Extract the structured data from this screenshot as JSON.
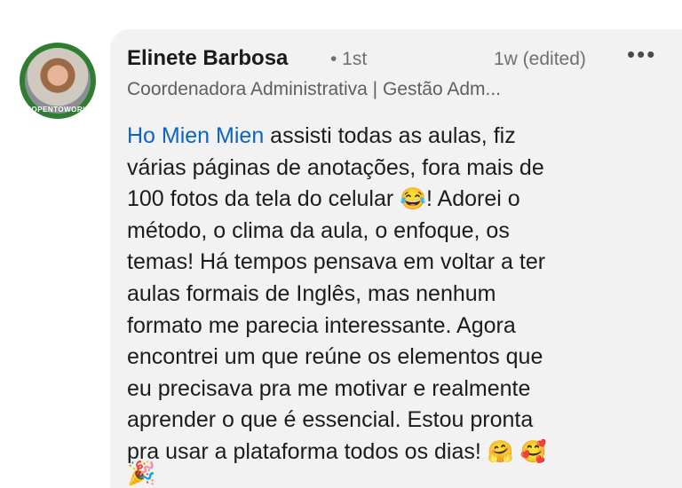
{
  "author": {
    "name": "Elinete Barbosa",
    "degree": "• 1st",
    "headline": "Coordenadora Administrativa | Gestão Adm...",
    "avatar_badge": "#OPENTOWORK"
  },
  "meta": {
    "time": "1w (edited)",
    "more_label": "•••"
  },
  "comment": {
    "mention": "Ho Mien Mien",
    "lines": [
      " assisti todas as aulas, fiz",
      "várias páginas de anotações, fora mais de",
      "100 fotos da tela do celular ",
      "! Adorei o",
      "método,  o clima da aula, o enfoque, os",
      "temas! Há  tempos pensava em voltar a ter",
      "aulas formais de Inglês, mas nenhum",
      "formato me parecia interessante. Agora",
      "encontrei um que reúne os elementos que",
      "eu precisava pra me motivar e realmente",
      "aprender o que é essencial. Estou pronta",
      "pra usar a plataforma todos os dias! "
    ],
    "emoji_laugh": "😂",
    "emoji_hug": "🤗",
    "emoji_love": "🥰",
    "emoji_party": "🎉"
  },
  "icons": {
    "avatar": "profile-photo",
    "more": "more-options-icon"
  }
}
